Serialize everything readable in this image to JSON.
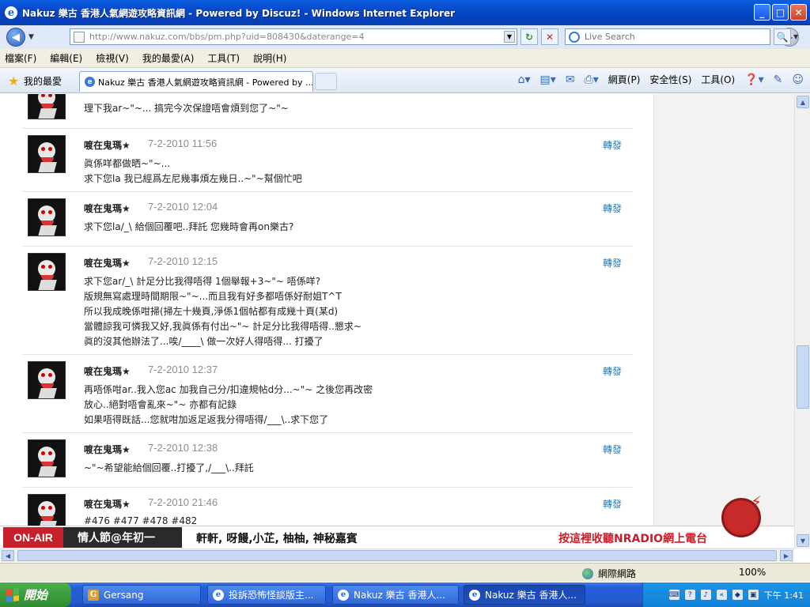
{
  "window": {
    "title": "Nakuz 樂古 香港人氣網遊攻略資訊網 - Powered by Discuz! - Windows Internet Explorer",
    "controls": [
      "_",
      "□",
      "✕"
    ]
  },
  "addressbar": {
    "url": "http://www.nakuz.com/bbs/pm.php?uid=808430&daterange=4",
    "search_placeholder": "Live Search"
  },
  "menu": [
    "檔案(F)",
    "編輯(E)",
    "檢視(V)",
    "我的最愛(A)",
    "工具(T)",
    "說明(H)"
  ],
  "tabbar": {
    "favorites_label": "我的最愛",
    "tab_title": "Nakuz 樂古 香港人氣網遊攻略資訊網 - Powered by ...",
    "commands": {
      "page": "網頁(P)",
      "safety": "安全性(S)",
      "tools": "工具(O)"
    }
  },
  "messages": [
    {
      "author": "",
      "date": "",
      "forward": "",
      "lines": [
        "理下我ar~\"~... 搞完今次保證唔會煩到您了~\"~"
      ]
    },
    {
      "author": "喥在鬼瑪★",
      "date": "7-2-2010 11:56",
      "forward": "轉發",
      "lines": [
        "眞係咩都做晒~\"~...",
        "求下您la 我已經爲左尼幾事煩左幾日..~\"~幫個忙吧"
      ]
    },
    {
      "author": "喥在鬼瑪★",
      "date": "7-2-2010 12:04",
      "forward": "轉發",
      "lines": [
        "求下您la/_\\ 給個回覆吧..拜託 您幾時會再on樂古?"
      ]
    },
    {
      "author": "喥在鬼瑪★",
      "date": "7-2-2010 12:15",
      "forward": "轉發",
      "lines": [
        "求下您ar/_\\ 計足分比我得唔得 1個舉報+3~\"~ 唔係咩?",
        "版規無寫處理時間期限~\"~...而且我有好多都唔係好耐姐T^T",
        "所以我成晚係咁掃(掃左十幾頁,淨係1個帖都有成幾十頁(某d)",
        "當體諒我可憐我又好,我眞係有付出~\"~ 計足分比我得唔得..懇求~",
        "眞的沒其他辦法了...唉/____\\ 做一次好人得唔得... 打擾了"
      ]
    },
    {
      "author": "喥在鬼瑪★",
      "date": "7-2-2010 12:37",
      "forward": "轉發",
      "lines": [
        "再唔係咁ar..我入您ac 加我自己分/扣違規帖d分...~\"~ 之後您再改密",
        "放心..絕對唔會亂來~\"~ 亦都有記錄",
        "如果唔得既話...您就咁加返足返我分得唔得/___\\..求下您了"
      ]
    },
    {
      "author": "喥在鬼瑪★",
      "date": "7-2-2010 12:38",
      "forward": "轉發",
      "lines": [
        "~\"~希望能給個回覆..打擾了,/___\\..拜託"
      ]
    },
    {
      "author": "喥在鬼瑪★",
      "date": "7-2-2010 21:46",
      "forward": "轉發",
      "lines": [
        "#476 #477 #478 #482"
      ]
    }
  ],
  "ad": {
    "onair": "ON-AIR",
    "show": "情人節@年初一",
    "guests": "軒軒, 呀饅,小芷, 柚柚, 神秘嘉賓",
    "call": "按這裡收聽NRADIO網上電台"
  },
  "statusbar": {
    "zone": "網際網路",
    "zoom": "100%"
  },
  "taskbar": {
    "start": "開始",
    "tasks": [
      "Gersang",
      "投訴恐怖怪談版主...",
      "Nakuz 樂古 香港人...",
      "Nakuz 樂古 香港人..."
    ],
    "clock": "下午 1:41"
  }
}
